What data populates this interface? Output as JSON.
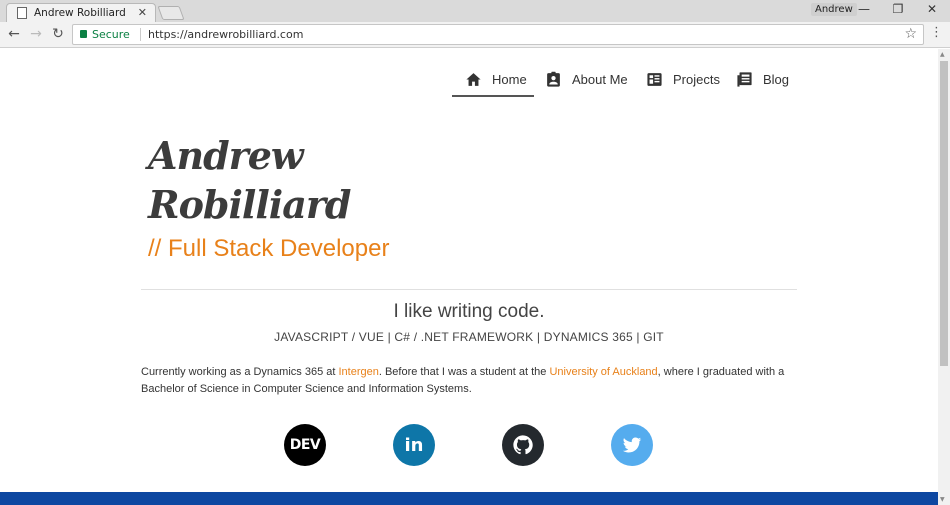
{
  "browser": {
    "tab_title": "Andrew Robilliard",
    "tab_close": "✕",
    "profile_name": "Andrew",
    "window_controls": {
      "minimize": "—",
      "restore": "❐",
      "close": "✕"
    },
    "nav": {
      "back": "←",
      "forward": "→",
      "reload": "↻"
    },
    "security_label": "Secure",
    "url": "https://andrewrobilliard.com",
    "bookmark_icon": "☆",
    "menu_icon": "⋮"
  },
  "site_nav": {
    "items": [
      {
        "label": "Home",
        "icon": "home-icon",
        "active": true
      },
      {
        "label": "About Me",
        "icon": "contact-card-icon",
        "active": false
      },
      {
        "label": "Projects",
        "icon": "projects-grid-icon",
        "active": false
      },
      {
        "label": "Blog",
        "icon": "blog-news-icon",
        "active": false
      }
    ]
  },
  "hero": {
    "name_line1": "Andrew",
    "name_line2": "Robilliard",
    "subtitle": "// Full Stack Developer"
  },
  "intro": {
    "tagline": "I like writing code.",
    "skills": "JAVASCRIPT / VUE | C# / .NET FRAMEWORK | DYNAMICS 365 | GIT",
    "bio_part1": "Currently working as a Dynamics 365 at ",
    "bio_link1": "Intergen",
    "bio_part2": ". Before that I was a student at the ",
    "bio_link2": "University of Auckland",
    "bio_part3": ", where I graduated with a Bachelor of Science in Computer Science and Information Systems."
  },
  "social": {
    "dev_label": "DEV",
    "linkedin_label": "in",
    "github_icon": "github-icon",
    "twitter_icon": "twitter-icon"
  },
  "colors": {
    "accent": "#e8811a",
    "footer": "#0d47a1",
    "linkedin": "#0e76a8",
    "twitter": "#55acee",
    "github": "#24292e"
  }
}
